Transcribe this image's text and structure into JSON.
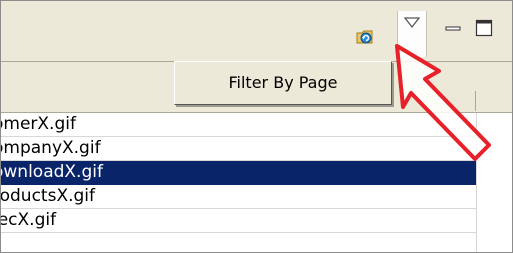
{
  "toolbar": {
    "icons": [
      "refresh-icon",
      "dropdown-menu-icon",
      "minimize-icon",
      "maximize-icon"
    ]
  },
  "menu": {
    "items": [
      {
        "label": "Filter By Page"
      }
    ]
  },
  "files": [
    {
      "name": "omerX.gif",
      "selected": false
    },
    {
      "name": "ompanyX.gif",
      "selected": false
    },
    {
      "name": "ownloadX.gif",
      "selected": true
    },
    {
      "name": "roductsX.gif",
      "selected": false
    },
    {
      "name": "lecX.gif",
      "selected": false
    }
  ],
  "colors": {
    "selection": "#0a246a",
    "annotation": "#e8202a",
    "chrome": "#ece9d8"
  }
}
